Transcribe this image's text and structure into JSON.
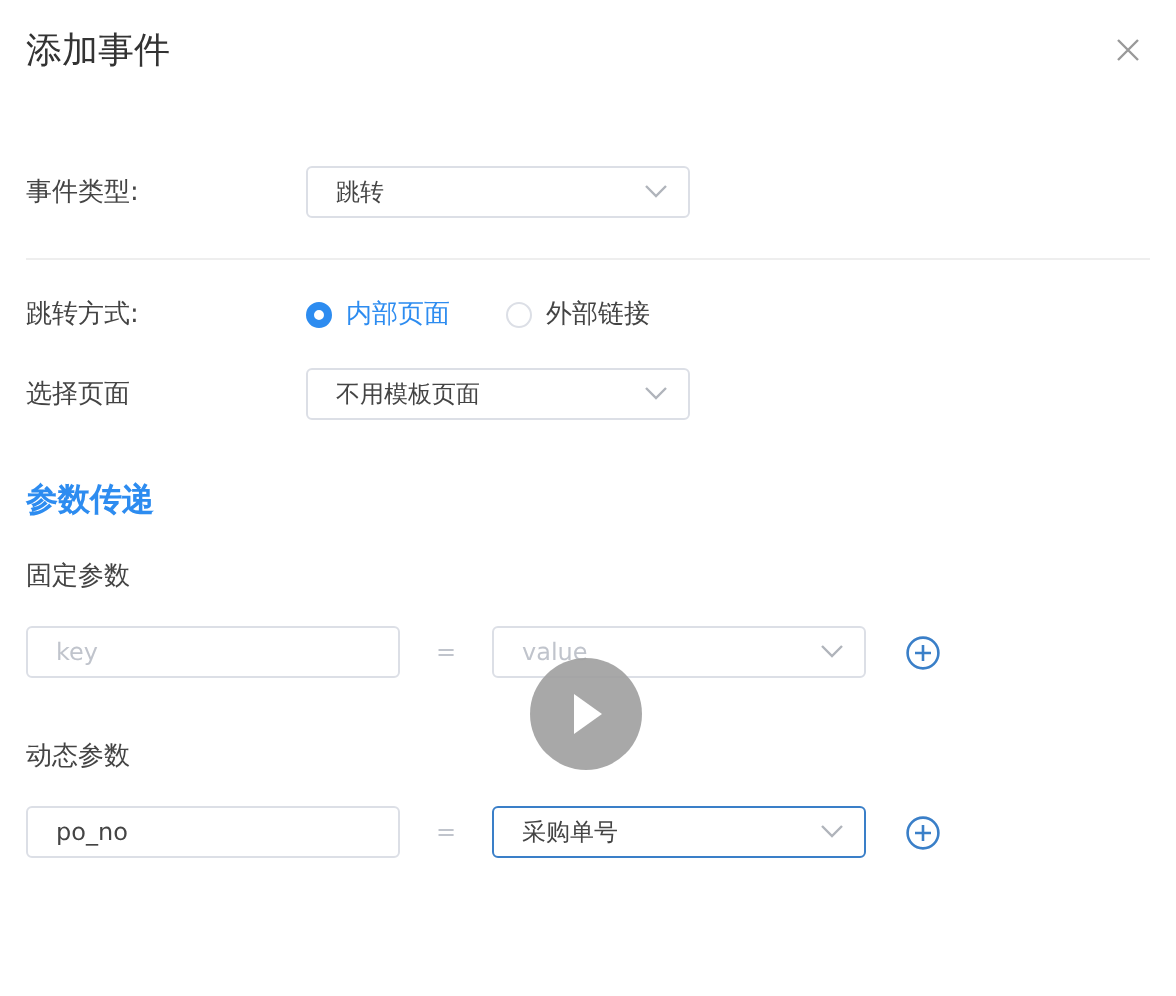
{
  "dialog": {
    "title": "添加事件"
  },
  "event_type": {
    "label": "事件类型:",
    "value": "跳转"
  },
  "jump_mode": {
    "label": "跳转方式:",
    "options": [
      {
        "label": "内部页面",
        "selected": true
      },
      {
        "label": "外部链接",
        "selected": false
      }
    ]
  },
  "page_select": {
    "label": "选择页面",
    "value": "不用模板页面"
  },
  "section_title": "参数传递",
  "param_groups": [
    {
      "label": "固定参数",
      "key": {
        "placeholder": "key"
      },
      "equals": "=",
      "value": {
        "placeholder": "value",
        "focused": false
      }
    },
    {
      "label": "动态参数",
      "key": {
        "value": "po_no"
      },
      "equals": "=",
      "value": {
        "value": "采购单号",
        "focused": true
      }
    }
  ]
}
